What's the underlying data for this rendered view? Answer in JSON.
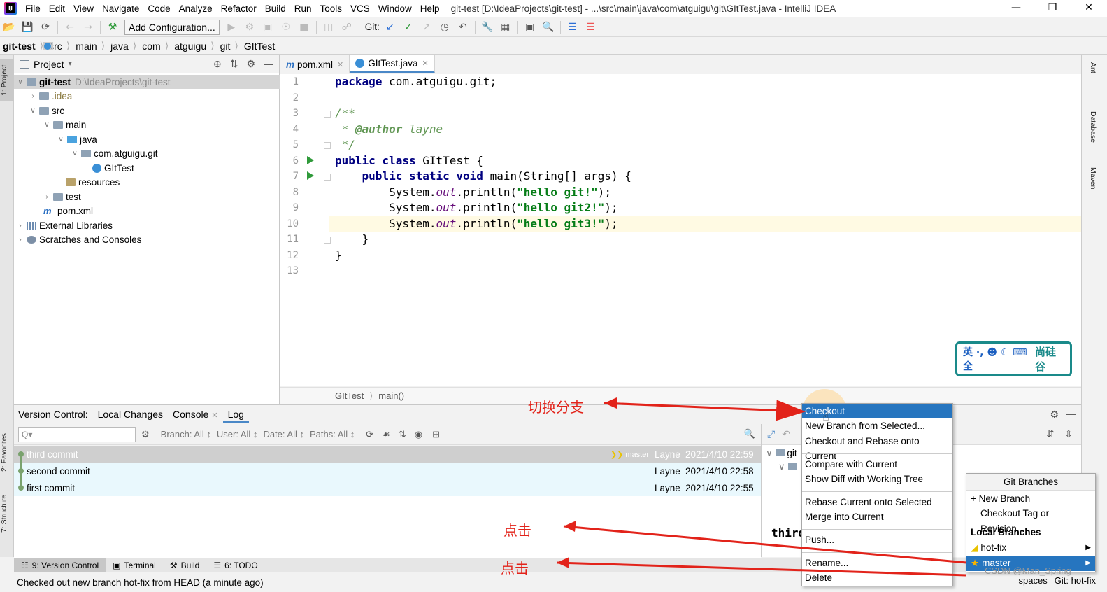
{
  "window": {
    "title": "git-test [D:\\IdeaProjects\\git-test] - ...\\src\\main\\java\\com\\atguigu\\git\\GItTest.java - IntelliJ IDEA",
    "menu": [
      "File",
      "Edit",
      "View",
      "Navigate",
      "Code",
      "Analyze",
      "Refactor",
      "Build",
      "Run",
      "Tools",
      "VCS",
      "Window",
      "Help"
    ]
  },
  "toolbar": {
    "add_config": "Add Configuration...",
    "git_label": "Git:"
  },
  "breadcrumb": [
    "git-test",
    "src",
    "main",
    "java",
    "com",
    "atguigu",
    "git",
    "GItTest"
  ],
  "left_strip": {
    "project": "1: Project",
    "favorites": "2: Favorites",
    "structure": "7: Structure"
  },
  "right_strip": {
    "ant": "Ant",
    "database": "Database",
    "maven": "Maven"
  },
  "project": {
    "title": "Project",
    "tree": [
      {
        "label": "git-test",
        "hint": "D:\\IdeaProjects\\git-test"
      },
      {
        "label": ".idea"
      },
      {
        "label": "src"
      },
      {
        "label": "main"
      },
      {
        "label": "java"
      },
      {
        "label": "com.atguigu.git"
      },
      {
        "label": "GItTest"
      },
      {
        "label": "resources"
      },
      {
        "label": "test"
      },
      {
        "label": "pom.xml"
      },
      {
        "label": "External Libraries"
      },
      {
        "label": "Scratches and Consoles"
      }
    ]
  },
  "editor": {
    "tabs": [
      {
        "label": "pom.xml"
      },
      {
        "label": "GItTest.java"
      }
    ],
    "line_numbers": [
      "1",
      "2",
      "3",
      "4",
      "5",
      "6",
      "7",
      "8",
      "9",
      "10",
      "11",
      "12",
      "13"
    ],
    "crumb_class": "GItTest",
    "crumb_method": "main()",
    "code": {
      "l1a": "package ",
      "l1b": "com.atguigu.git;",
      "l3": "/**",
      "l4a": " * ",
      "l4b": "@author",
      "l4c": " layne",
      "l5": " */",
      "l6a": "public class ",
      "l6b": "GItTest {",
      "l7a": "    public static void ",
      "l7b": "main(String[] args) {",
      "s1": "\"hello git!\"",
      "s2": "\"hello git2!\"",
      "s3": "\"hello git3!\"",
      "sys": "        System.",
      "out": "out",
      "println": ".println(",
      "end": ");",
      "l11": "    }",
      "l12": "}"
    }
  },
  "vc": {
    "tabs": [
      "Version Control:",
      "Local Changes",
      "Console",
      "Log"
    ],
    "search_placeholder": "Q▾",
    "filters": [
      "Branch: All ↕",
      "User: All ↕",
      "Date: All ↕",
      "Paths: All ↕"
    ],
    "commits": [
      {
        "msg": "third commit",
        "tag": "master",
        "author": "Layne",
        "date": "2021/4/10 22:59"
      },
      {
        "msg": "second commit",
        "tag": "",
        "author": "Layne",
        "date": "2021/4/10 22:58"
      },
      {
        "msg": "first commit",
        "tag": "",
        "author": "Layne",
        "date": "2021/4/10 22:55"
      }
    ],
    "detail_root": "git",
    "detail_msg": "third"
  },
  "context_menu": {
    "items": [
      "Checkout",
      "New Branch from Selected...",
      "Checkout and Rebase onto Current",
      "Compare with Current",
      "Show Diff with Working Tree",
      "Rebase Current onto Selected",
      "Merge into Current",
      "Push...",
      "Rename...",
      "Delete"
    ]
  },
  "branches": {
    "title": "Git Branches",
    "new_branch": "+ New Branch",
    "checkout_tag": "Checkout Tag or Revision...",
    "local_header": "Local Branches",
    "local": [
      {
        "name": "hot-fix"
      },
      {
        "name": "master"
      }
    ]
  },
  "bottom_tabs": [
    "9: Version Control",
    "Terminal",
    "Build",
    "6: TODO"
  ],
  "status": {
    "message": "Checked out new branch hot-fix from HEAD (a minute ago)",
    "indent": "spaces",
    "branch": "Git: hot-fix"
  },
  "annotations": {
    "switch": "切换分支",
    "click1": "点击",
    "click2": "点击"
  },
  "logo": {
    "left": "英 ·, ☻ ☾ ⌨ 全",
    "right": "尚硅谷"
  },
  "watermark": "CSDN @Man_Spring",
  "colors": {
    "accent": "#2675bf",
    "annotation": "#e2231a",
    "selection": "#cfcfcf"
  }
}
